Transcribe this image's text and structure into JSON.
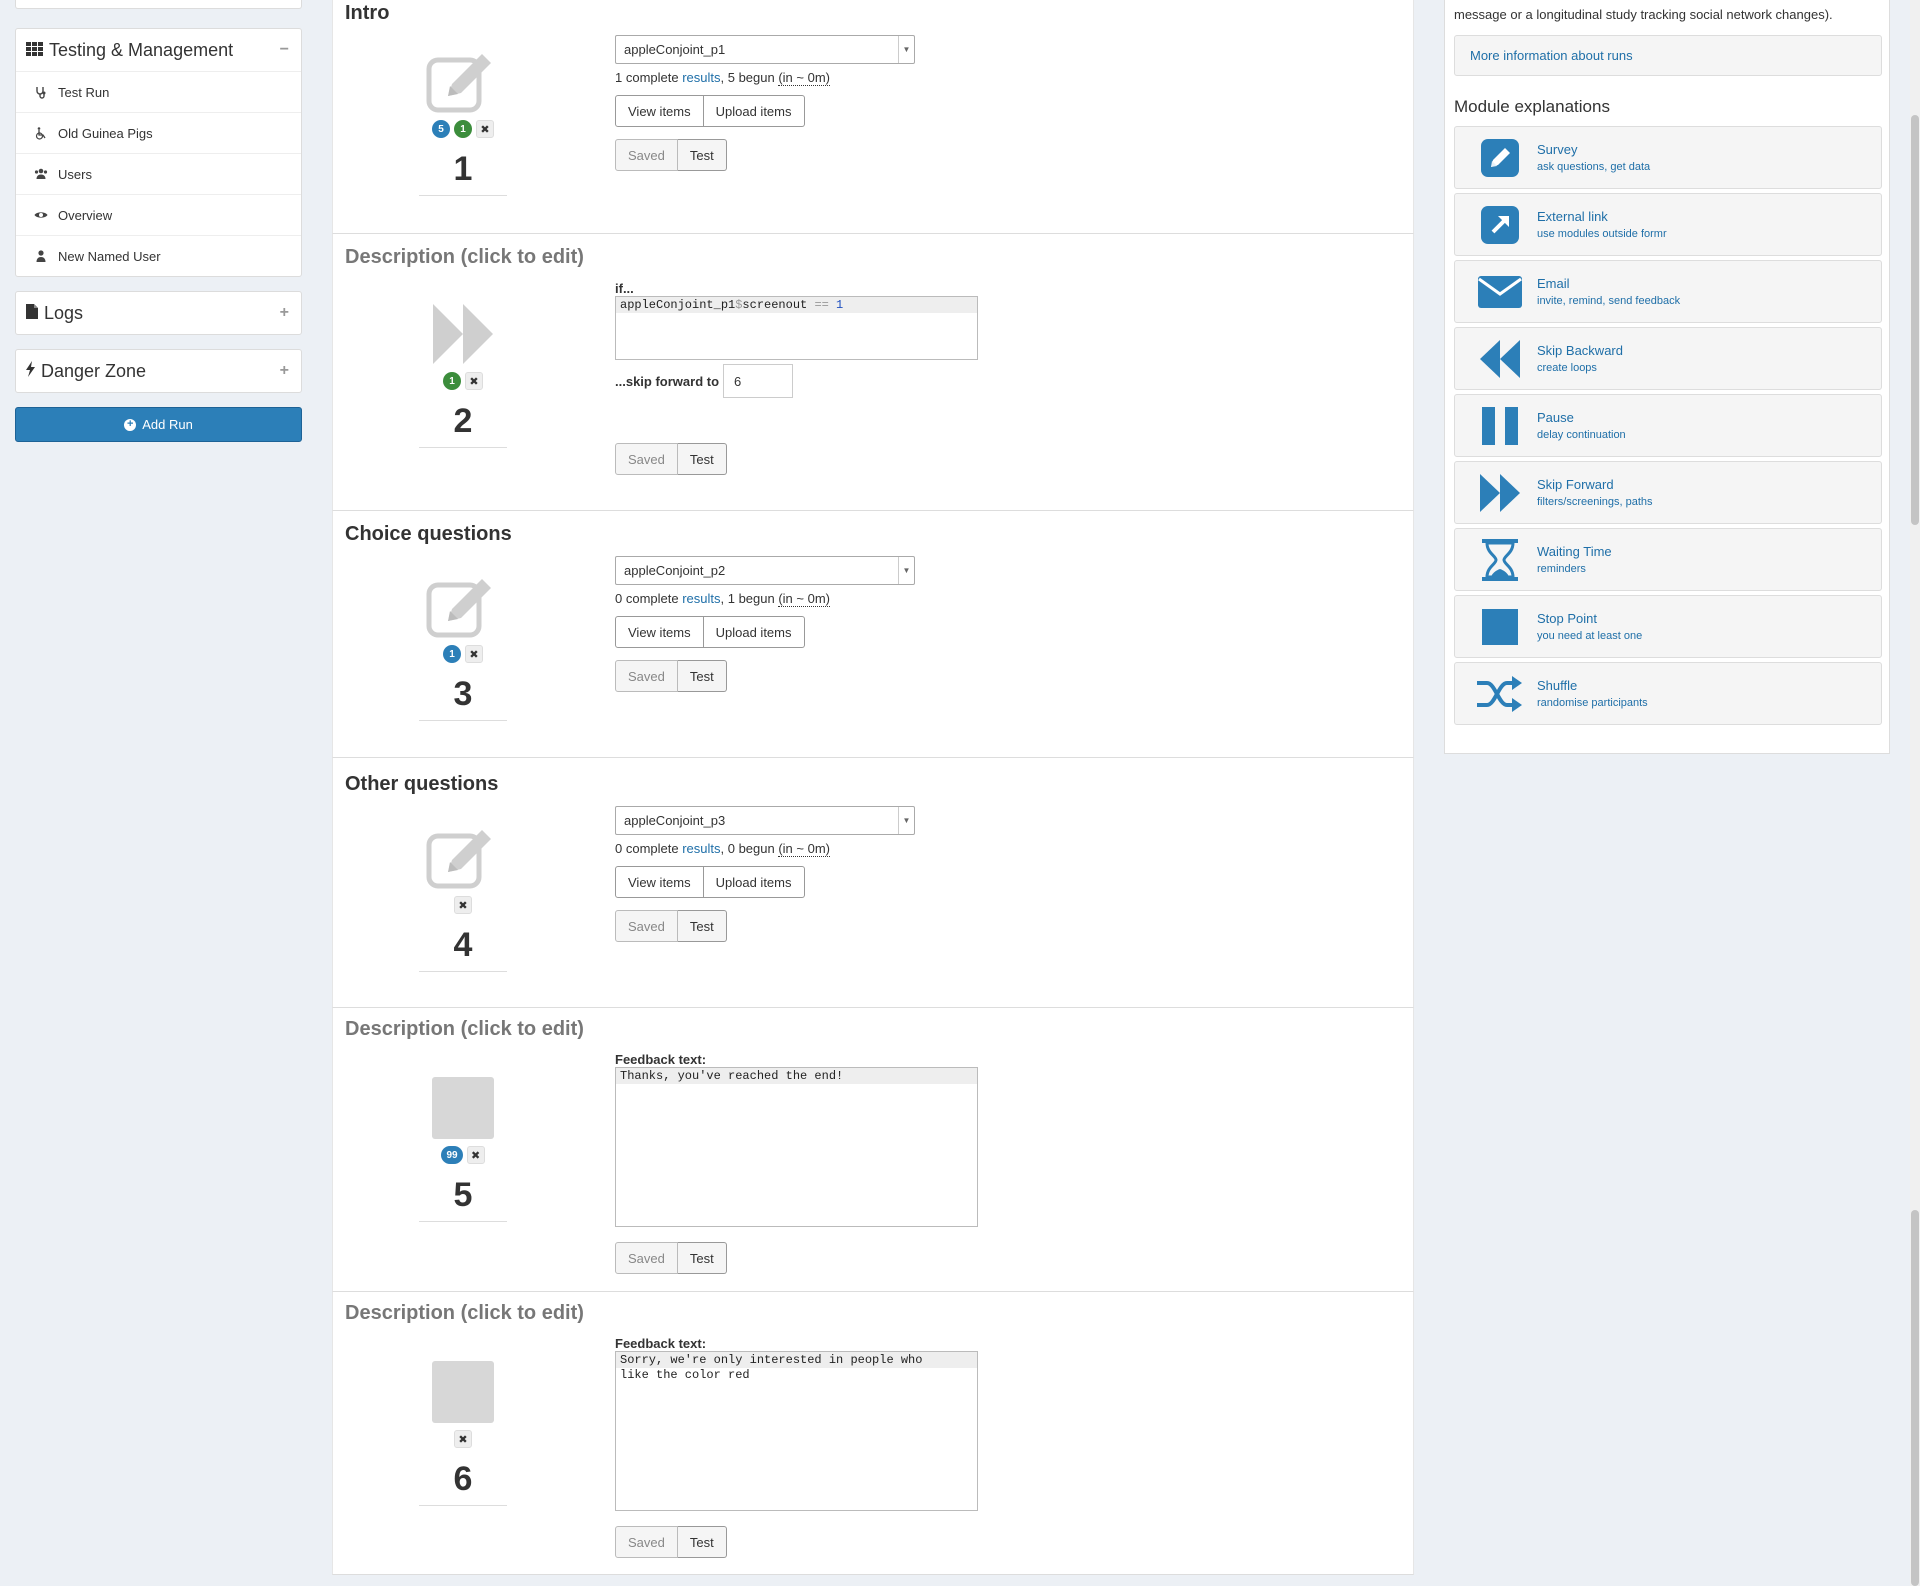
{
  "sidebar": {
    "testing": {
      "title": "Testing & Management",
      "toggle": "−",
      "items": [
        {
          "label": "Test Run",
          "icon": "stethoscope-icon"
        },
        {
          "label": "Old Guinea Pigs",
          "icon": "wheelchair-icon"
        },
        {
          "label": "Users",
          "icon": "users-icon"
        },
        {
          "label": "Overview",
          "icon": "eye-icon"
        },
        {
          "label": "New Named User",
          "icon": "user-icon"
        }
      ]
    },
    "logs": {
      "title": "Logs",
      "toggle": "+"
    },
    "danger": {
      "title": "Danger Zone",
      "toggle": "+"
    },
    "add_run_label": "Add Run"
  },
  "modules": [
    {
      "title": "Intro",
      "type": "survey",
      "position": "1",
      "survey": "appleConjoint_p1",
      "complete": "1 complete ",
      "results": "results",
      "begun": ", 5 begun ",
      "eta": "(in ~ 0m)",
      "badges": [
        "5",
        "1"
      ],
      "view_items": "View items",
      "upload_items": "Upload items",
      "saved": "Saved",
      "test": "Test"
    },
    {
      "title": "Description (click to edit)",
      "type": "skip_forward",
      "position": "2",
      "if_label": "if...",
      "code_var": "appleConjoint_p1",
      "code_dollar": "$",
      "code_field": "screenout",
      "code_op": "==",
      "code_val": "1",
      "skip_label": "...skip forward to",
      "skip_value": "6",
      "badges": [
        "1"
      ],
      "saved": "Saved",
      "test": "Test"
    },
    {
      "title": "Choice questions",
      "type": "survey",
      "position": "3",
      "survey": "appleConjoint_p2",
      "complete": "0 complete ",
      "results": "results",
      "begun": ", 1 begun ",
      "eta": "(in ~ 0m)",
      "badges": [
        "1"
      ],
      "view_items": "View items",
      "upload_items": "Upload items",
      "saved": "Saved",
      "test": "Test"
    },
    {
      "title": "Other questions",
      "type": "survey",
      "position": "4",
      "survey": "appleConjoint_p3",
      "complete": "0 complete ",
      "results": "results",
      "begun": ", 0 begun ",
      "eta": "(in ~ 0m)",
      "badges": [],
      "view_items": "View items",
      "upload_items": "Upload items",
      "saved": "Saved",
      "test": "Test"
    },
    {
      "title": "Description (click to edit)",
      "type": "stop",
      "position": "5",
      "feedback_label": "Feedback text:",
      "feedback_lines": [
        "Thanks, you've reached the end!"
      ],
      "badges": [
        "99"
      ],
      "saved": "Saved",
      "test": "Test"
    },
    {
      "title": "Description (click to edit)",
      "type": "stop",
      "position": "6",
      "feedback_label": "Feedback text:",
      "feedback_lines": [
        "Sorry, we're only interested in people who",
        "like the color red"
      ],
      "badges": [],
      "saved": "Saved",
      "test": "Test"
    }
  ],
  "right_panel": {
    "intro_text": "message or a longitudinal study tracking social network changes).",
    "more_info": "More information about runs",
    "heading": "Module explanations",
    "modules": [
      {
        "name": "Survey",
        "desc": "ask questions, get data",
        "icon": "pencil-icon"
      },
      {
        "name": "External link",
        "desc": "use modules outside formr",
        "icon": "external-link-icon"
      },
      {
        "name": "Email",
        "desc": "invite, remind, send feedback",
        "icon": "envelope-icon"
      },
      {
        "name": "Skip Backward",
        "desc": "create loops",
        "icon": "backward-icon"
      },
      {
        "name": "Pause",
        "desc": "delay continuation",
        "icon": "pause-icon"
      },
      {
        "name": "Skip Forward",
        "desc": "filters/screenings, paths",
        "icon": "forward-icon"
      },
      {
        "name": "Waiting Time",
        "desc": "reminders",
        "icon": "hourglass-icon"
      },
      {
        "name": "Stop Point",
        "desc": "you need at least one",
        "icon": "stop-icon"
      },
      {
        "name": "Shuffle",
        "desc": "randomise participants",
        "icon": "shuffle-icon"
      }
    ]
  },
  "colors": {
    "accent": "#2c7fb8",
    "badge_green": "#3c8d3c",
    "background": "#ecf0f5"
  }
}
